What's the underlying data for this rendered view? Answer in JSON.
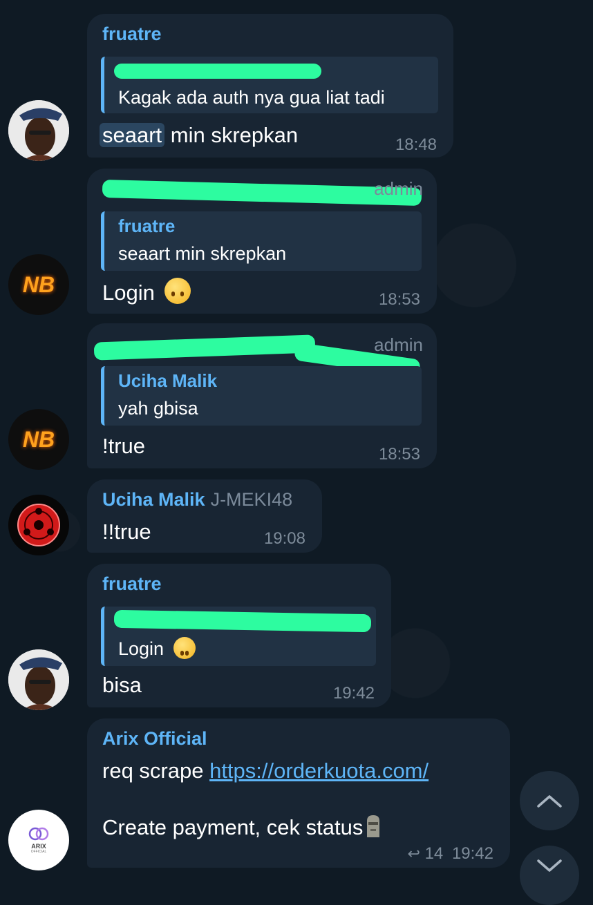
{
  "messages": [
    {
      "sender": "fruatre",
      "quote_text": "Kagak ada auth nya gua liat tadi",
      "text_highlight": "seaart",
      "text_rest": " min skrepkan",
      "time": "18:48",
      "avatar": "person-photo"
    },
    {
      "role": "admin",
      "quote_name": "fruatre",
      "quote_text": "seaart min skrepkan",
      "text": "Login",
      "emoji": "upside-down-face",
      "time": "18:53",
      "avatar_label": "NB"
    },
    {
      "role": "admin",
      "quote_name": "Uciha Malik",
      "quote_text": "yah gbisa",
      "text": "!true",
      "time": "18:53",
      "avatar_label": "NB"
    },
    {
      "sender": "Uciha Malik",
      "role": "J-MEKI48",
      "text": "!!true",
      "time": "19:08"
    },
    {
      "sender": "fruatre",
      "quote_text": "Login",
      "emoji": "upside-down-face",
      "text": "bisa",
      "time": "19:42"
    },
    {
      "sender": "Arix Official",
      "text_prefix": "req scrape ",
      "link": "https://orderkuota.com/",
      "text2": "Create payment, cek status",
      "emoji": "moai",
      "replies": "14",
      "time": "19:42",
      "avatar_label": "ARIX",
      "avatar_sublabel": "OFFICIAL"
    }
  ],
  "colors": {
    "background": "#0f1a24",
    "bubble": "#182533",
    "accent": "#5eb5f7",
    "redaction": "#2dfca0"
  }
}
